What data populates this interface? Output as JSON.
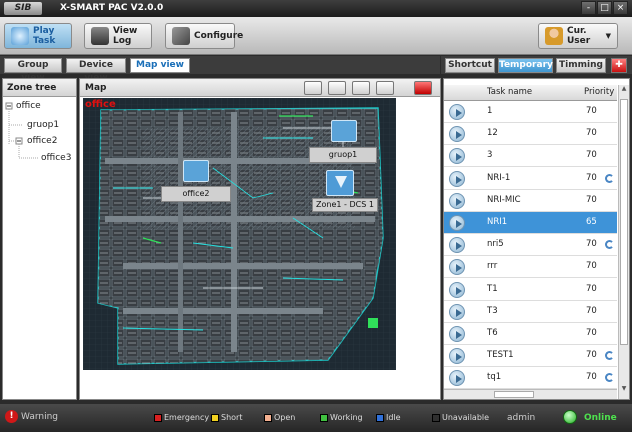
{
  "app": {
    "logo_text": "SIB",
    "title": "X-SMART PAC V2.0.0"
  },
  "window_buttons": [
    "-",
    "□",
    "×"
  ],
  "toolbar": {
    "play_task": "Play Task",
    "view_log": "View Log",
    "configure": "Configure",
    "user": "Cur. User"
  },
  "view_tabs": [
    "Group view",
    "Device view",
    "Map view"
  ],
  "zone_tree": {
    "title": "Zone tree",
    "nodes": [
      "office",
      "gruop1",
      "office2",
      "office3"
    ]
  },
  "map": {
    "title": "Map",
    "overlay_text": "office",
    "labels": {
      "gruop1": "gruop1",
      "office2": "office2",
      "zone": "Zone1 - DCS 1"
    }
  },
  "right_tabs": [
    "Shortcut",
    "Temporary",
    "Timming"
  ],
  "task_table": {
    "headers": [
      "Task name",
      "Priority"
    ],
    "rows": [
      {
        "name": "1",
        "priority": "70",
        "refresh": false
      },
      {
        "name": "12",
        "priority": "70",
        "refresh": false
      },
      {
        "name": "3",
        "priority": "70",
        "refresh": false
      },
      {
        "name": "NRI-1",
        "priority": "70",
        "refresh": true
      },
      {
        "name": "NRI-MIC",
        "priority": "70",
        "refresh": false
      },
      {
        "name": "NRI1",
        "priority": "65",
        "refresh": false,
        "selected": true
      },
      {
        "name": "nri5",
        "priority": "70",
        "refresh": true
      },
      {
        "name": "rrr",
        "priority": "70",
        "refresh": false
      },
      {
        "name": "T1",
        "priority": "70",
        "refresh": false
      },
      {
        "name": "T3",
        "priority": "70",
        "refresh": false
      },
      {
        "name": "T6",
        "priority": "70",
        "refresh": false
      },
      {
        "name": "TEST1",
        "priority": "70",
        "refresh": true
      },
      {
        "name": "tq1",
        "priority": "70",
        "refresh": true
      }
    ]
  },
  "status": {
    "warning": "Warning",
    "legend": [
      {
        "label": "Emergency",
        "color": "#d92020"
      },
      {
        "label": "Short",
        "color": "#f0d020"
      },
      {
        "label": "Open",
        "color": "#f4b090"
      },
      {
        "label": "Working",
        "color": "#40c040"
      },
      {
        "label": "Idle",
        "color": "#3070d8"
      },
      {
        "label": "Unavailable",
        "color": "#303030"
      }
    ],
    "user": "admin",
    "online": "Online"
  }
}
